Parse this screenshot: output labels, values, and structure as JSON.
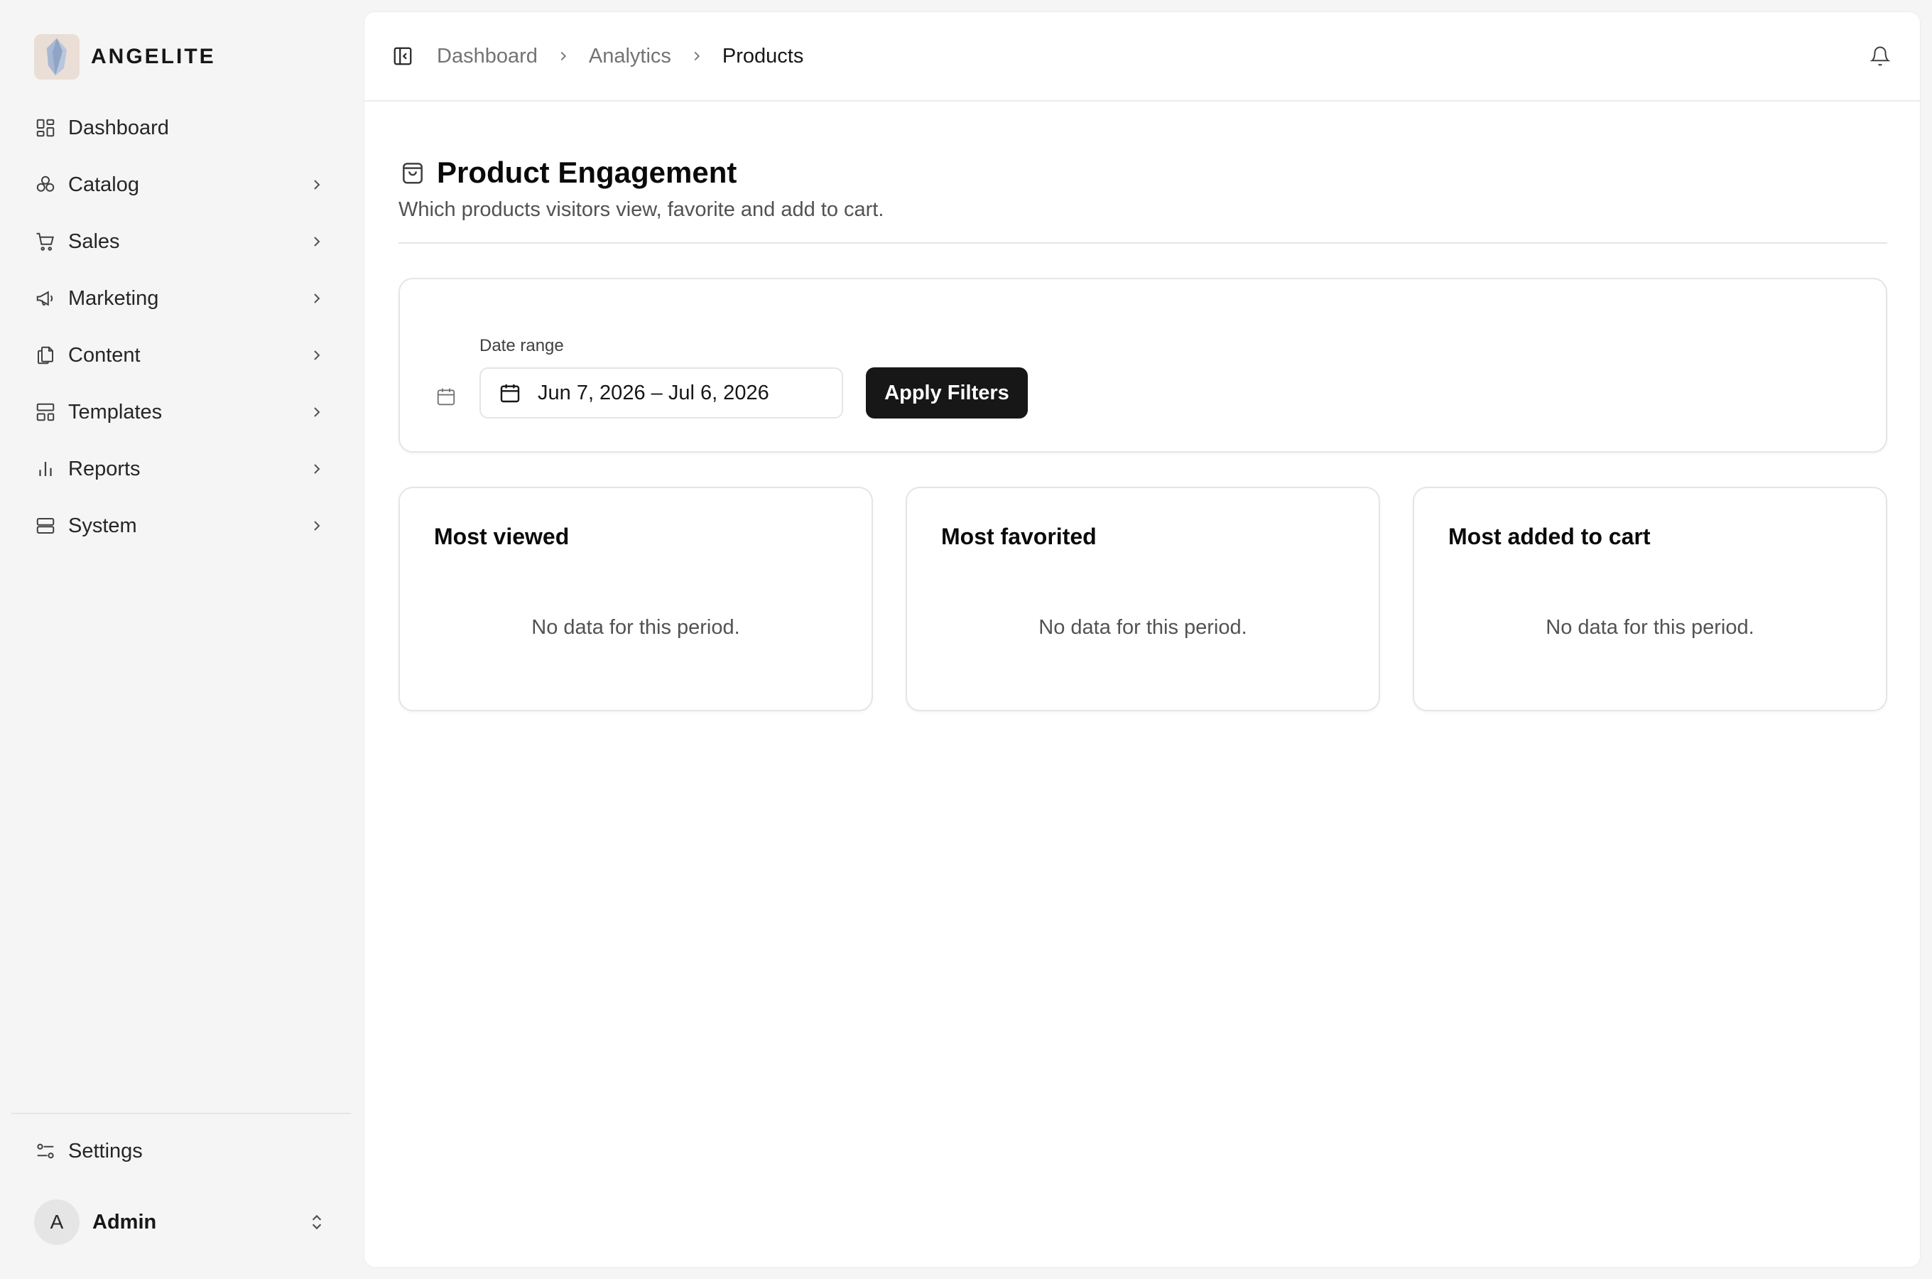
{
  "brand": {
    "name": "ANGELITE"
  },
  "sidebar": {
    "items": [
      {
        "label": "Dashboard",
        "icon": "dashboard-icon",
        "has_children": false
      },
      {
        "label": "Catalog",
        "icon": "catalog-icon",
        "has_children": true
      },
      {
        "label": "Sales",
        "icon": "cart-icon",
        "has_children": true
      },
      {
        "label": "Marketing",
        "icon": "megaphone-icon",
        "has_children": true
      },
      {
        "label": "Content",
        "icon": "files-icon",
        "has_children": true
      },
      {
        "label": "Templates",
        "icon": "layout-icon",
        "has_children": true
      },
      {
        "label": "Reports",
        "icon": "bar-chart-icon",
        "has_children": true
      },
      {
        "label": "System",
        "icon": "server-icon",
        "has_children": true
      }
    ],
    "settings_label": "Settings",
    "user": {
      "initial": "A",
      "name": "Admin"
    }
  },
  "topbar": {
    "breadcrumbs": [
      "Dashboard",
      "Analytics",
      "Products"
    ]
  },
  "page": {
    "title": "Product Engagement",
    "subtitle": "Which products visitors view, favorite and add to cart."
  },
  "filters": {
    "date_label": "Date range",
    "date_value": "Jun 7, 2026 – Jul 6, 2026",
    "apply_label": "Apply Filters"
  },
  "cards": [
    {
      "title": "Most viewed",
      "empty_text": "No data for this period."
    },
    {
      "title": "Most favorited",
      "empty_text": "No data for this period."
    },
    {
      "title": "Most added to cart",
      "empty_text": "No data for this period."
    }
  ],
  "colors": {
    "primary_button": "#171717",
    "sidebar_bg": "#f5f5f5",
    "panel_bg": "#ffffff"
  }
}
